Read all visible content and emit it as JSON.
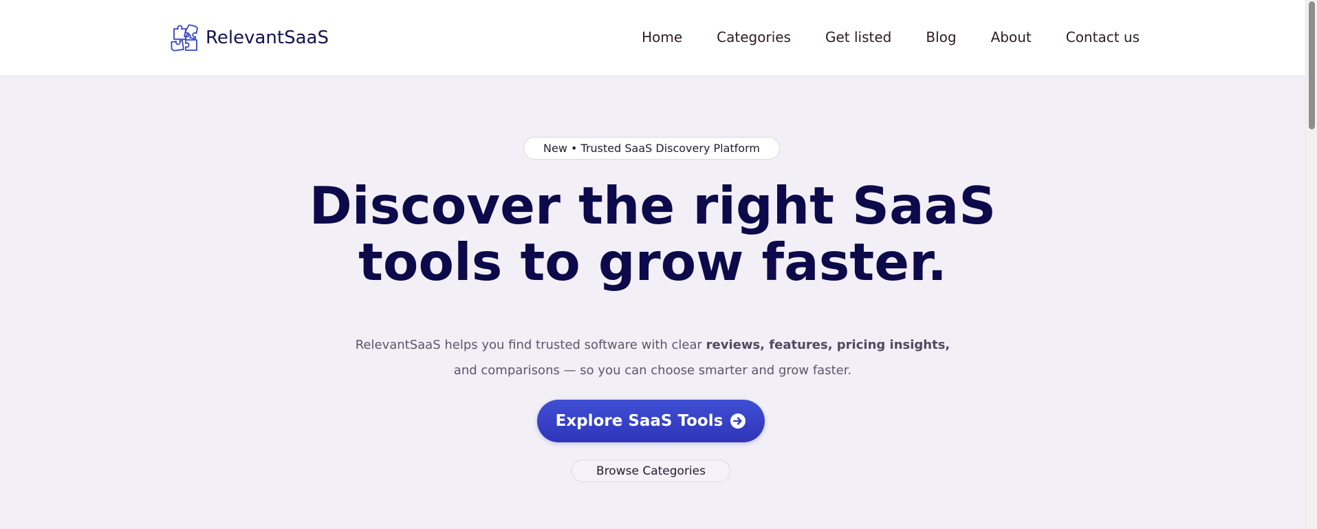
{
  "header": {
    "brand_name": "RelevantSaaS",
    "nav": [
      {
        "label": "Home"
      },
      {
        "label": "Categories"
      },
      {
        "label": "Get listed"
      },
      {
        "label": "Blog"
      },
      {
        "label": "About"
      },
      {
        "label": "Contact us"
      }
    ]
  },
  "hero": {
    "badge": "New • Trusted SaaS Discovery Platform",
    "title_line_1": "Discover the right SaaS",
    "title_line_2": "tools to grow faster.",
    "subtitle": {
      "part_1": "RelevantSaaS helps you find trusted software with clear ",
      "bold": "reviews, features, pricing insights,",
      "part_2": " and comparisons — so you can choose smarter and grow faster."
    },
    "primary_cta": "Explore SaaS Tools",
    "primary_cta_icon": "arrow-circle-right-icon",
    "secondary_cta": "Browse Categories"
  },
  "colors": {
    "brand_navy": "#0c0a4a",
    "accent_blue": "#3440c6",
    "page_background": "#f2eff6",
    "header_background": "#ffffff"
  }
}
